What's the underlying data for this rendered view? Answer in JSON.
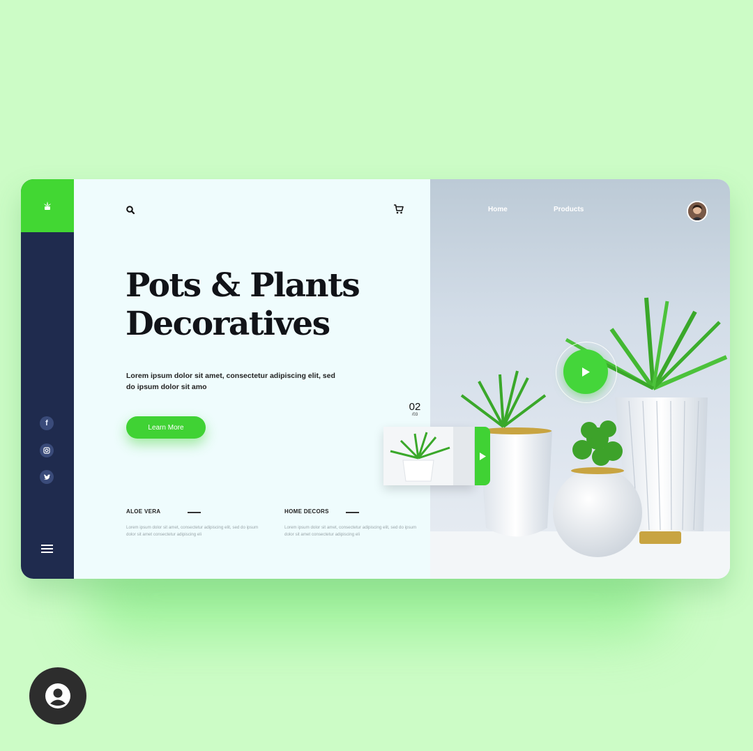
{
  "nav": {
    "home_label": "Home",
    "products_label": "Products"
  },
  "hero": {
    "title_line1": "Pots & Plants",
    "title_line2": "Decoratives",
    "description": "Lorem ipsum dolor sit amet, consectetur adipiscing elit, sed do  ipsum dolor sit amo",
    "button_label": "Learn More"
  },
  "slider": {
    "current": "02",
    "total": "/03"
  },
  "features": [
    {
      "title": "ALOE VERA",
      "text": "Lorem ipsum dolor sit amet, consectetur adipiscing elit, sed do  ipsum dolor sit amet consectetur adipiscing eli"
    },
    {
      "title": "HOME DECORS",
      "text": "Lorem ipsum dolor sit amet, consectetur adipiscing elit, sed do  ipsum dolor sit amet consectetur adipiscing eli"
    }
  ],
  "social": [
    "f",
    "instagram",
    "twitter"
  ],
  "icons": {
    "logo": "plant-icon",
    "search": "search-icon",
    "cart": "cart-icon",
    "menu": "hamburger-icon",
    "play": "play-icon",
    "user": "user-icon"
  },
  "colors": {
    "background": "#ccfcc6",
    "accent": "#42d733",
    "sidebar": "#1f2b4e",
    "main_panel": "#effcfd"
  }
}
